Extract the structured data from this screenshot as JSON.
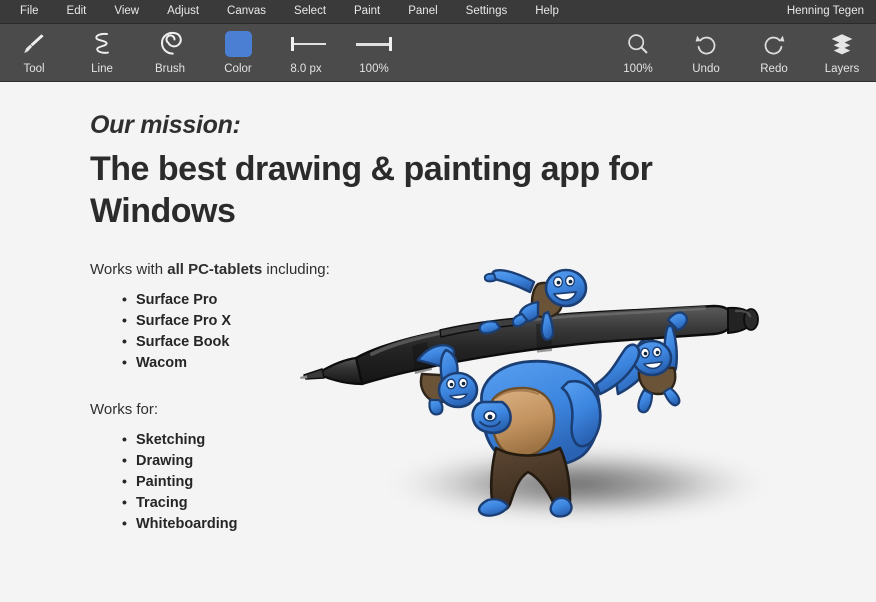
{
  "menubar": {
    "items": [
      {
        "label": "File",
        "name": "menu-file"
      },
      {
        "label": "Edit",
        "name": "menu-edit"
      },
      {
        "label": "View",
        "name": "menu-view"
      },
      {
        "label": "Adjust",
        "name": "menu-adjust"
      },
      {
        "label": "Canvas",
        "name": "menu-canvas"
      },
      {
        "label": "Select",
        "name": "menu-select"
      },
      {
        "label": "Paint",
        "name": "menu-paint"
      },
      {
        "label": "Panel",
        "name": "menu-panel"
      },
      {
        "label": "Settings",
        "name": "menu-settings"
      },
      {
        "label": "Help",
        "name": "menu-help"
      }
    ],
    "user": "Henning Tegen"
  },
  "toolbar": {
    "left": [
      {
        "label": "Tool",
        "icon": "paintbrush-icon"
      },
      {
        "label": "Line",
        "icon": "squiggle-line-icon"
      },
      {
        "label": "Brush",
        "icon": "spiral-brush-icon"
      },
      {
        "label": "Color",
        "icon": "color-swatch-icon"
      },
      {
        "label": "8.0 px",
        "icon": "brush-size-slider-icon"
      },
      {
        "label": "100%",
        "icon": "opacity-slider-icon"
      }
    ],
    "right": [
      {
        "label": "100%",
        "icon": "magnifier-icon"
      },
      {
        "label": "Undo",
        "icon": "undo-arrow-icon"
      },
      {
        "label": "Redo",
        "icon": "redo-arrow-icon"
      },
      {
        "label": "Layers",
        "icon": "layers-stack-icon"
      }
    ],
    "color_value": "#4a7fd4",
    "brush_size": "8.0 px",
    "opacity": "100%",
    "zoom": "100%"
  },
  "content": {
    "eyebrow": "Our mission:",
    "headline": "The best drawing & painting app for Windows",
    "lead_one_prefix": "Works with ",
    "lead_one_bold": "all PC-tablets",
    "lead_one_suffix": " including:",
    "tablets": [
      "Surface Pro",
      "Surface Pro X",
      "Surface Book",
      "Wacom"
    ],
    "lead_two": "Works for:",
    "uses": [
      "Sketching",
      "Drawing",
      "Painting",
      "Tracing",
      "Whiteboarding"
    ]
  },
  "illustration": {
    "alt": "Blue cartoon ogre carrying a giant black stylus pen with three small blue creatures",
    "colors": {
      "blue": "#3d86e0",
      "blue_dark": "#1f4e91",
      "skin": "#c99a68",
      "pants": "#4d3b2a",
      "pen_body": "#2d2d2d",
      "shadow": "#5a5a5a"
    }
  },
  "theme": {
    "menubar_bg": "#3a3a3a",
    "toolbar_bg": "#4b4b4b",
    "page_bg": "#f4f4f4",
    "text": "#2b2b2b",
    "toolbar_text": "#e3e3e3"
  }
}
